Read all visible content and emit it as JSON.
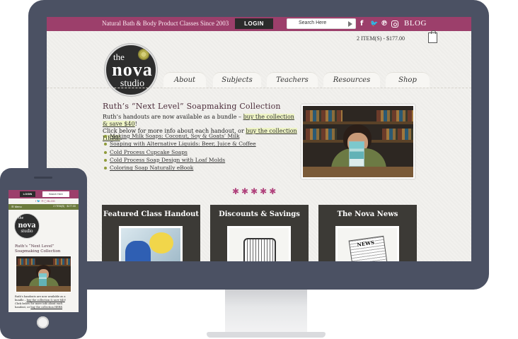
{
  "desktop": {
    "topbar": {
      "tagline": "Natural Bath & Body Product Classes Since 2003",
      "login": "LOGIN",
      "search_placeholder": "Search Here",
      "social": {
        "facebook": "f",
        "twitter": "🐦",
        "pinterest": "℗"
      },
      "blog": "BLOG"
    },
    "cart": {
      "summary": "2 ITEM(S) - $177.00"
    },
    "logo": {
      "the": "the",
      "nova": "nova",
      "studio": "studio"
    },
    "nav": [
      "About",
      "Subjects",
      "Teachers",
      "Resources",
      "Shop"
    ],
    "intro": {
      "title": "Ruth’s “Next Level” Soapmaking Collection",
      "line1_prefix": "Ruth’s handouts are now available as a bundle – ",
      "link_buy_save": "buy the collection & save $40",
      "line1_suffix": "!",
      "line2_prefix": "Click below for more info about each handout, or ",
      "link_buy_here": "buy the collection HERE",
      "line2_suffix": ".",
      "bullets": [
        "Making Milk Soaps: Coconut, Soy & Goats’ Milk",
        "Soaping with Alternative Liquids: Beer, Juice & Coffee",
        "Cold Process Cupcake Soaps",
        "Cold Process Soap Design with Loaf Molds",
        "Coloring Soap Naturally eBook"
      ]
    },
    "slider_dots": "✱✱✱✱✱",
    "features": [
      {
        "title": "Featured Class Handout"
      },
      {
        "title": "Discounts & Savings"
      },
      {
        "title": "The Nova News"
      }
    ],
    "news_label": "NEWS"
  },
  "phone": {
    "login": "LOGIN",
    "search_placeholder": "Search Here",
    "social": "f 🐦 ℗ ◻ BLOG",
    "menu": "☰ Menu",
    "cart": "2 ITEM(S) · $177.00",
    "logo": {
      "the": "the",
      "nova": "nova",
      "studio": "studio"
    },
    "title": "Ruth’s “Next Level” Soapmaking Collection",
    "text_prefix": "Ruth’s handouts are now available as a bundle – ",
    "link_buy_save": "buy the collection & save $40",
    "text_middle": "! Click below for more info about each handout, or ",
    "link_buy_here": "buy the collection HERE",
    "text_suffix": "."
  },
  "colors": {
    "brand": "#9c3f6b",
    "frame": "#4b5163",
    "accent_green": "#6b7a3c"
  }
}
